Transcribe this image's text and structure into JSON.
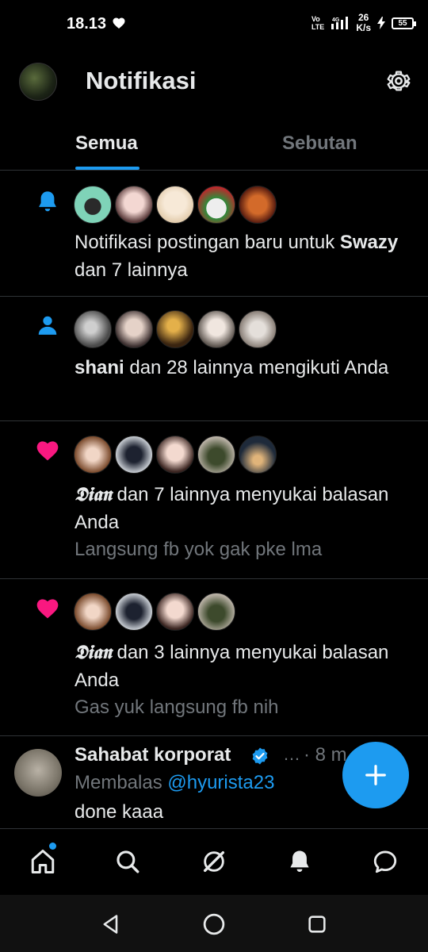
{
  "status_bar": {
    "time": "18.13",
    "network": "Vo LTE 4G",
    "speed_value": "26",
    "speed_unit": "K/s",
    "battery": "55"
  },
  "header": {
    "title": "Notifikasi"
  },
  "tabs": [
    {
      "label": "Semua",
      "active": true
    },
    {
      "label": "Sebutan",
      "active": false
    }
  ],
  "notifications": [
    {
      "icon": "bell-icon",
      "name": "Swazy",
      "text_before": "Notifikasi postingan baru untuk ",
      "text_after": " dan 7 lainnya",
      "sub": ""
    },
    {
      "icon": "person-icon",
      "name": "shani",
      "text_after": " dan 28 lainnya mengikuti Anda",
      "sub": ""
    },
    {
      "icon": "heart-icon",
      "name": "𝕯𝖎𝖆𝖓",
      "text_after": " dan 7 lainnya menyukai balasan Anda",
      "sub": "Langsung fb yok gak pke lma"
    },
    {
      "icon": "heart-icon",
      "name": "𝕯𝖎𝖆𝖓",
      "text_after": " dan 3 lainnya menyukai balasan Anda",
      "sub": "Gas yuk langsung fb nih"
    }
  ],
  "reply": {
    "author": "Sahabat korporat",
    "ellipsis": "…",
    "time": "· 8 m",
    "replying_prefix": "Membalas ",
    "replying_handle": "@hyurista23",
    "body": "done kaaa"
  },
  "colors": {
    "accent": "#1d9bf0",
    "like": "#f91880",
    "text": "#e7e9ea",
    "muted": "#71767b",
    "divider": "#2f3336"
  }
}
